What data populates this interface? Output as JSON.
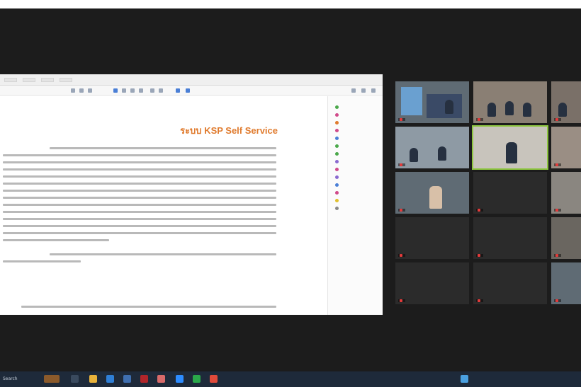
{
  "document": {
    "tabs": [
      "",
      "",
      "",
      ""
    ],
    "title": "ระบบ KSP Self Service",
    "sidebar_items": [
      "",
      "",
      "",
      "",
      "",
      "",
      "",
      "",
      "",
      "",
      "",
      "",
      "",
      "",
      ""
    ]
  },
  "gallery": {
    "tiles": [
      {
        "name": "",
        "label": ""
      },
      {
        "name": "",
        "label": ""
      },
      {
        "name": "",
        "label": ""
      },
      {
        "name": "",
        "label": ""
      },
      {
        "name": "",
        "label": ""
      },
      {
        "name": "",
        "label": ""
      },
      {
        "name": "",
        "label": ""
      },
      {
        "name": "",
        "label": ""
      },
      {
        "name": "",
        "label": ""
      },
      {
        "name": "",
        "label": ""
      },
      {
        "name": "",
        "label": ""
      },
      {
        "name": "",
        "label": ""
      },
      {
        "name": "",
        "label": ""
      },
      {
        "name": "",
        "label": ""
      },
      {
        "name": "",
        "label": ""
      }
    ]
  },
  "taskbar": {
    "search_placeholder": "Search",
    "tray_text": "",
    "clock": ""
  },
  "colors": {
    "title_accent": "#e07b2e",
    "active_speaker": "#8ec63f",
    "mute": "#e23b3b",
    "taskbar": "#1e2a3a"
  }
}
